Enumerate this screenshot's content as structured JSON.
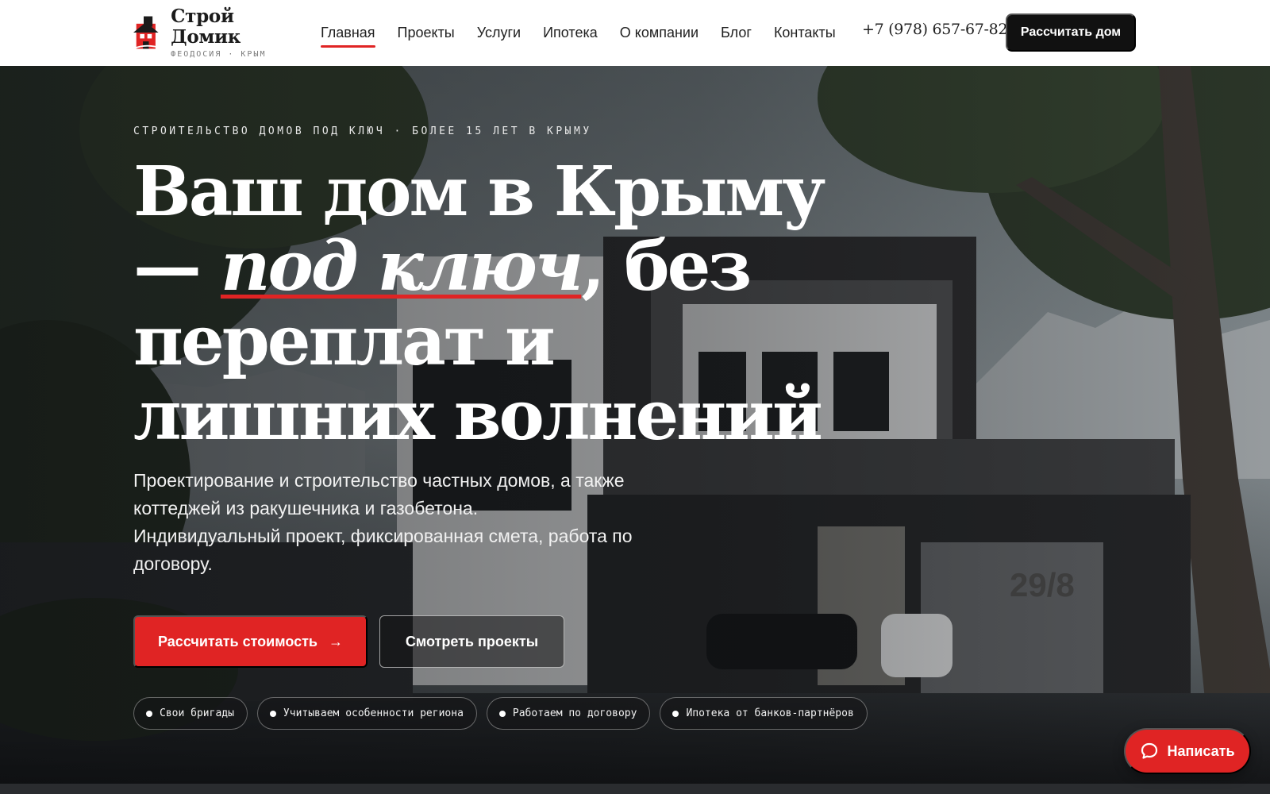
{
  "header": {
    "logo": {
      "title": "Строй Домик",
      "subtitle": "ФЕОДОСИЯ · КРЫМ"
    },
    "nav": [
      {
        "label": "Главная",
        "active": true
      },
      {
        "label": "Проекты",
        "active": false
      },
      {
        "label": "Услуги",
        "active": false
      },
      {
        "label": "Ипотека",
        "active": false
      },
      {
        "label": "О компании",
        "active": false
      },
      {
        "label": "Блог",
        "active": false
      },
      {
        "label": "Контакты",
        "active": false
      }
    ],
    "phone": "+7 (978) 657-67-82",
    "cta_label": "Рассчитать дом"
  },
  "hero": {
    "kicker": "СТРОИТЕЛЬСТВО ДОМОВ ПОД КЛЮЧ · БОЛЕЕ 15 ЛЕТ В КРЫМУ",
    "headline_part1": "Ваш дом в Крыму —",
    "headline_accent": "под ключ",
    "headline_part2": ", без переплат и лишних волнений",
    "lead_line1": "Проектирование и строительство частных домов, а также коттеджей из ракушечника и газобетона.",
    "lead_line2": "Индивидуальный проект, фиксированная смета, работа по договору.",
    "primary_button": "Рассчитать стоимость",
    "primary_button_arrow": "→",
    "secondary_button": "Смотреть проекты",
    "features": [
      "Свои бригады",
      "Учитываем особенности региона",
      "Работаем по договору",
      "Ипотека от банков-партнёров"
    ],
    "house_number": "29/8"
  },
  "chat": {
    "label": "Написать"
  },
  "colors": {
    "accent": "#e02424",
    "dark": "#111111",
    "header_bg": "#ffffff"
  }
}
